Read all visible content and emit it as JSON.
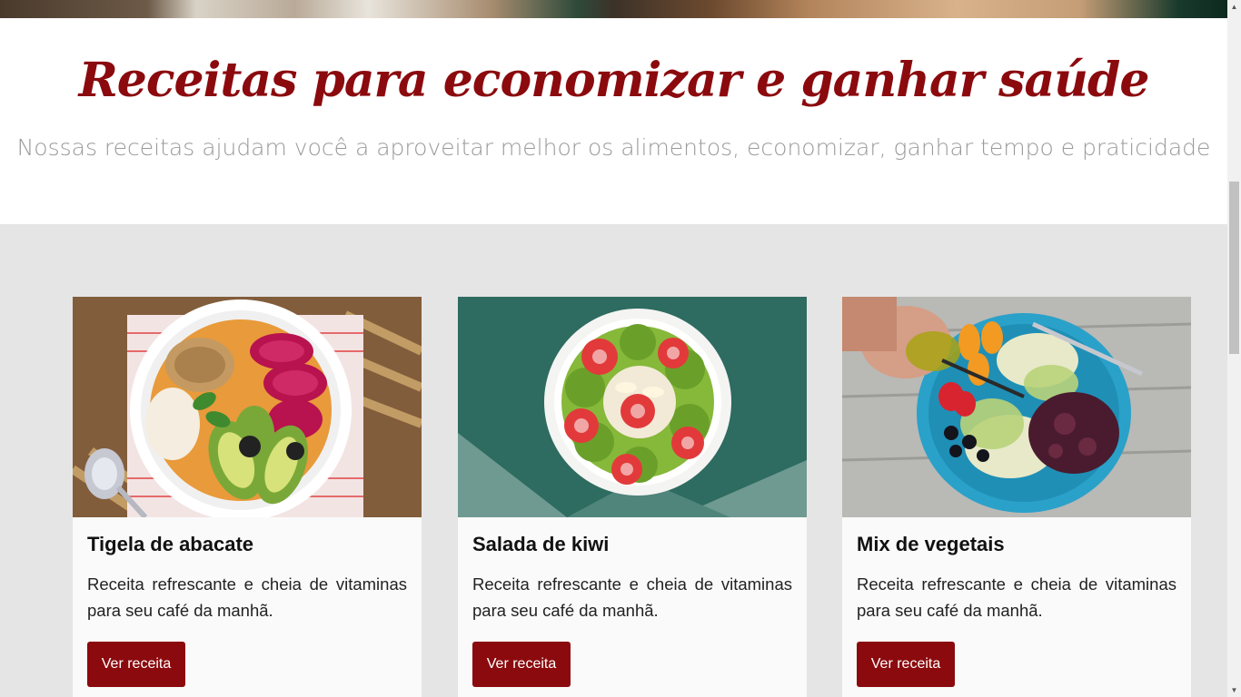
{
  "intro": {
    "title": "Receitas para economizar e ganhar saúde",
    "subtitle": "Nossas receitas ajudam você a aproveitar melhor os alimentos, economizar, ganhar tempo e praticidade"
  },
  "recipes": [
    {
      "title": "Tigela de abacate",
      "description": "Receita refrescante e cheia de vitaminas para seu café da manhã.",
      "button": "Ver receita"
    },
    {
      "title": "Salada de kiwi",
      "description": "Receita refrescante e cheia de vitaminas para seu café da manhã.",
      "button": "Ver receita"
    },
    {
      "title": "Mix de vegetais",
      "description": "Receita refrescante e cheia de vitaminas para seu café da manhã.",
      "button": "Ver receita"
    }
  ],
  "colors": {
    "brand": "#8b0a0e",
    "section_bg": "#e5e5e5",
    "card_bg": "#fafafa"
  }
}
